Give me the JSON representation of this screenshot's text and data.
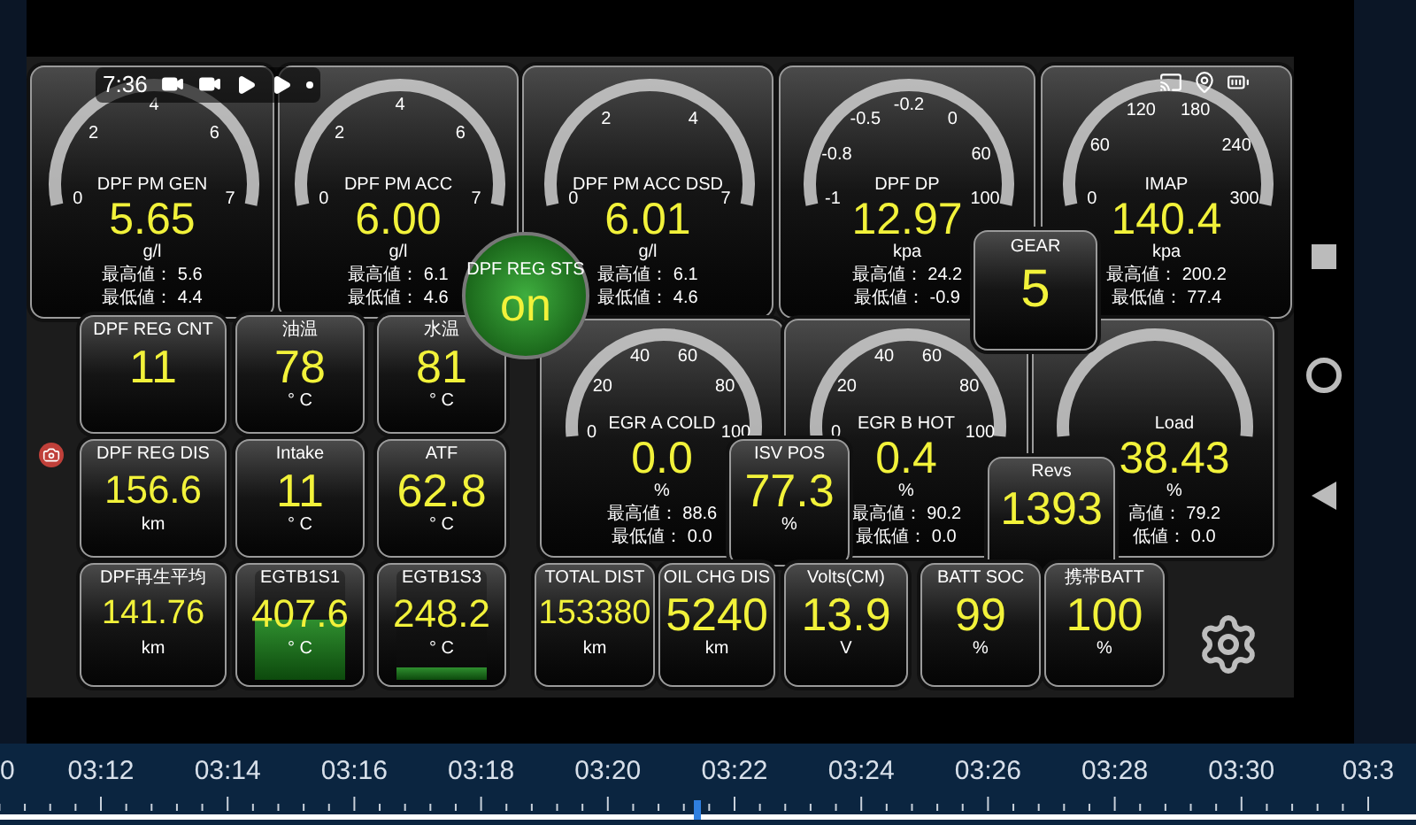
{
  "status_bar": {
    "time": "7:36"
  },
  "gauges": [
    {
      "title": "DPF PM GEN",
      "value": "5.65",
      "unit": "g/l",
      "max": "最高値： 5.6",
      "min": "最低値： 4.4",
      "ticks": [
        "0",
        "2",
        "4",
        "6",
        "7"
      ]
    },
    {
      "title": "DPF PM ACC",
      "value": "6.00",
      "unit": "g/l",
      "max": "最高値： 6.1",
      "min": "最低値： 4.6",
      "ticks": [
        "0",
        "2",
        "4",
        "6",
        "7"
      ]
    },
    {
      "title": "DPF PM ACC DSD",
      "value": "6.01",
      "unit": "g/l",
      "max": "最高値： 6.1",
      "min": "最低値： 4.6",
      "ticks": [
        "0",
        "2",
        "4",
        "7"
      ]
    },
    {
      "title": "DPF DP",
      "value": "12.97",
      "unit": "kpa",
      "max": "最高値： 24.2",
      "min": "最低値： -0.9",
      "ticks": [
        "-1",
        "-0.8",
        "-0.5",
        "-0.2",
        "0",
        "60",
        "100"
      ]
    },
    {
      "title": "IMAP",
      "value": "140.4",
      "unit": "kpa",
      "max": "最高値： 200.2",
      "min": "最低値： 77.4",
      "ticks": [
        "0",
        "60",
        "120",
        "180",
        "240",
        "300"
      ]
    },
    {
      "title": "EGR A COLD",
      "value": "0.0",
      "unit": "%",
      "max": "最高値： 88.6",
      "min": "最低値： 0.0",
      "ticks": [
        "0",
        "20",
        "40",
        "60",
        "80",
        "100"
      ]
    },
    {
      "title": "EGR B HOT",
      "value": "0.4",
      "unit": "%",
      "max": "最高値： 90.2",
      "min": "最低値： 0.0",
      "ticks": [
        "0",
        "20",
        "40",
        "60",
        "80",
        "100"
      ]
    },
    {
      "title": "Load",
      "value": "38.43",
      "unit": "%",
      "max": "高値： 79.2",
      "min": "低値： 0.0"
    }
  ],
  "tiles": [
    {
      "title": "DPF REG CNT",
      "value": "11"
    },
    {
      "title": "油温",
      "value": "78",
      "unit": "° C"
    },
    {
      "title": "水温",
      "value": "81",
      "unit": "° C"
    },
    {
      "title": "DPF REG DIS",
      "value": "156.6",
      "unit": "km"
    },
    {
      "title": "Intake",
      "value": "11",
      "unit": "° C"
    },
    {
      "title": "ATF",
      "value": "62.8",
      "unit": "° C"
    },
    {
      "title": "ISV POS",
      "value": "77.3",
      "unit": "%"
    },
    {
      "title": "Revs",
      "value": "1393"
    },
    {
      "title": "DPF再生平均",
      "value": "141.76",
      "unit": "km"
    },
    {
      "title": "EGTB1S1",
      "value": "407.6",
      "unit": "° C",
      "level": 0.55
    },
    {
      "title": "EGTB1S3",
      "value": "248.2",
      "unit": "° C",
      "level": 0.12
    },
    {
      "title": "TOTAL DIST",
      "value": "153380",
      "unit": "km"
    },
    {
      "title": "OIL CHG DIS",
      "value": "5240",
      "unit": "km"
    },
    {
      "title": "Volts(CM)",
      "value": "13.9",
      "unit": "V"
    },
    {
      "title": "BATT SOC",
      "value": "99",
      "unit": "%"
    },
    {
      "title": "携帯BATT",
      "value": "100",
      "unit": "%"
    }
  ],
  "gear": {
    "title": "GEAR",
    "value": "5"
  },
  "regen_status": {
    "title": "DPF REG STS",
    "value": "on"
  },
  "timeline": {
    "labels": [
      "0",
      "03:12",
      "03:14",
      "03:16",
      "03:18",
      "03:20",
      "03:22",
      "03:24",
      "03:26",
      "03:28",
      "03:30",
      "03:3"
    ],
    "level": 0.49
  }
}
